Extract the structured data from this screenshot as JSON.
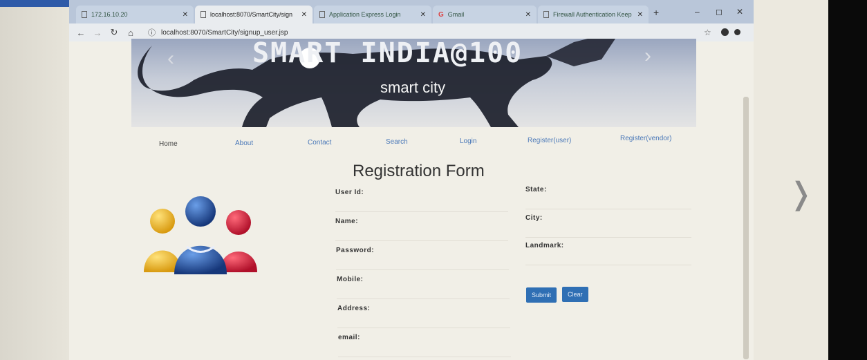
{
  "browser": {
    "tabs": [
      {
        "label": "172.16.10.20",
        "icon": "document-icon"
      },
      {
        "label": "localhost:8070/SmartCity/sign",
        "icon": "document-icon",
        "active": true
      },
      {
        "label": "Application Express Login",
        "icon": "document-icon"
      },
      {
        "label": "Gmail",
        "icon": "google-icon"
      },
      {
        "label": "Firewall Authentication Keep",
        "icon": "document-icon"
      }
    ],
    "url": "localhost:8070/SmartCity/signup_user.jsp",
    "window_controls": {
      "minimize": "–",
      "maximize": "◻",
      "close": "✕"
    },
    "new_tab": "+"
  },
  "banner": {
    "title": "SMART INDIA@100",
    "subtitle": "smart city"
  },
  "nav": {
    "items": [
      "Home",
      "About",
      "Contact",
      "Search",
      "Login",
      "Register(user)",
      "Register(vendor)"
    ]
  },
  "form": {
    "title": "Registration Form",
    "left_fields": [
      "User Id:",
      "Name:",
      "Password:",
      "Mobile:",
      "Address:",
      "email:"
    ],
    "right_fields": [
      "State:",
      "City:",
      "Landmark:"
    ],
    "submit_label": "Submit",
    "clear_label": "Clear"
  },
  "colors": {
    "accent": "#2f6fb4",
    "link": "#4a78b8"
  }
}
